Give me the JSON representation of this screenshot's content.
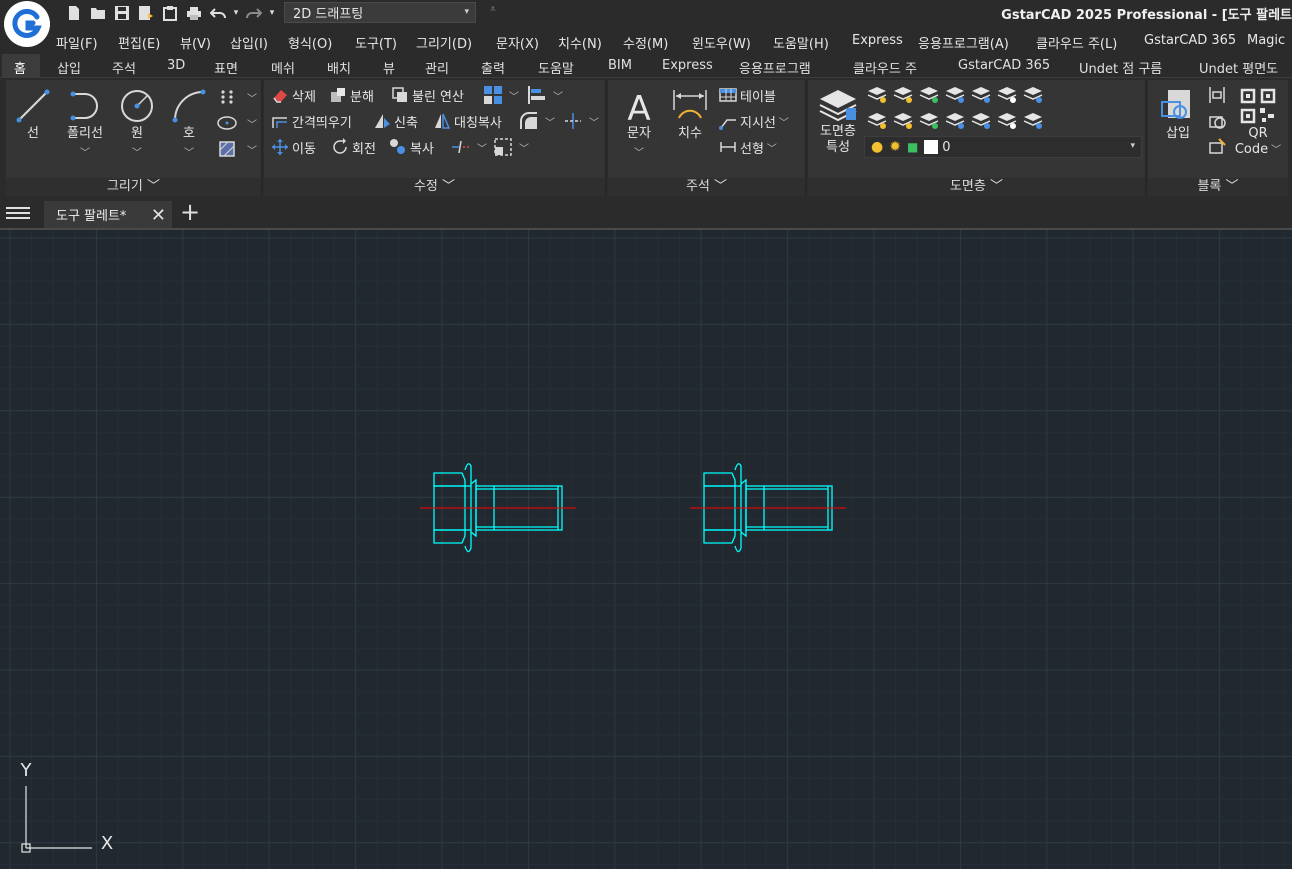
{
  "quick_access": {
    "icons": [
      "new-icon",
      "open-icon",
      "save-icon",
      "save-as-icon",
      "publish-icon",
      "print-icon",
      "undo-icon",
      "redo-icon"
    ],
    "workspace": "2D 드래프팅"
  },
  "app_title": "GstarCAD 2025 Professional - [도구 팔레트",
  "menu": [
    "파일(F)",
    "편집(E)",
    "뷰(V)",
    "삽입(I)",
    "형식(O)",
    "도구(T)",
    "그리기(D)",
    "문자(X)",
    "치수(N)",
    "수정(M)",
    "윈도우(W)",
    "도움말(H)",
    "Express",
    "응용프로그램(A)",
    "클라우드 주(L)",
    "GstarCAD 365",
    "Magic"
  ],
  "ribbon_tabs": [
    "홈",
    "삽입",
    "주석",
    "3D",
    "표면",
    "메쉬",
    "배치",
    "뷰",
    "관리",
    "출력",
    "도움말",
    "BIM",
    "Express",
    "응용프로그램",
    "클라우드 주",
    "GstarCAD 365",
    "Undet 점 구름",
    "Undet 평면도"
  ],
  "panels": {
    "draw": {
      "title": "그리기",
      "line": "선",
      "polyline": "폴리선",
      "circle": "원",
      "arc": "호"
    },
    "modify": {
      "title": "수정",
      "erase": "삭제",
      "explode": "분해",
      "boolean": "불린 연산",
      "offset": "간격띄우기",
      "stretch": "신축",
      "mirror": "대칭복사",
      "move": "이동",
      "rotate": "회전",
      "copy": "복사"
    },
    "annotation": {
      "title": "주석",
      "text": "문자",
      "dimension": "치수",
      "table": "테이블",
      "leader": "지시선",
      "linear": "선형"
    },
    "layers": {
      "title": "도면층",
      "properties_line1": "도면층",
      "properties_line2": "특성",
      "current_layer": "0"
    },
    "block": {
      "title": "블록",
      "insert": "삽입",
      "qr_line1": "QR",
      "qr_line2": "Code"
    }
  },
  "doc_tab": {
    "label": "도구 팔레트*"
  },
  "ucs": {
    "x_label": "X",
    "y_label": "Y"
  },
  "colors": {
    "canvas": "#212830",
    "grid_major": "#2f3a45",
    "grid_minor": "#262e37",
    "drawing": "#00ffff",
    "centerline": "#ff0000"
  }
}
